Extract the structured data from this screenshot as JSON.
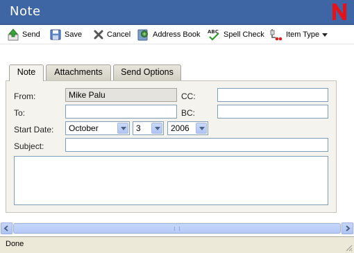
{
  "window": {
    "title": "Note"
  },
  "toolbar": {
    "send": "Send",
    "save": "Save",
    "cancel": "Cancel",
    "address_book": "Address Book",
    "spell_check": "Spell Check",
    "item_type": "Item Type"
  },
  "tabs": [
    {
      "label": "Note",
      "active": true
    },
    {
      "label": "Attachments",
      "active": false
    },
    {
      "label": "Send Options",
      "active": false
    }
  ],
  "form": {
    "from_label": "From:",
    "from_value": "Mike Palu",
    "cc_label": "CC:",
    "cc_value": "",
    "to_label": "To:",
    "to_value": "",
    "bc_label": "BC:",
    "bc_value": "",
    "start_date_label": "Start Date:",
    "month": "October",
    "day": "3",
    "year": "2006",
    "subject_label": "Subject:",
    "subject_value": "",
    "message": ""
  },
  "status": {
    "text": "Done"
  },
  "colors": {
    "titlebar": "#3f66a4",
    "logo": "#e4121b",
    "panel": "#f4f3ee"
  }
}
